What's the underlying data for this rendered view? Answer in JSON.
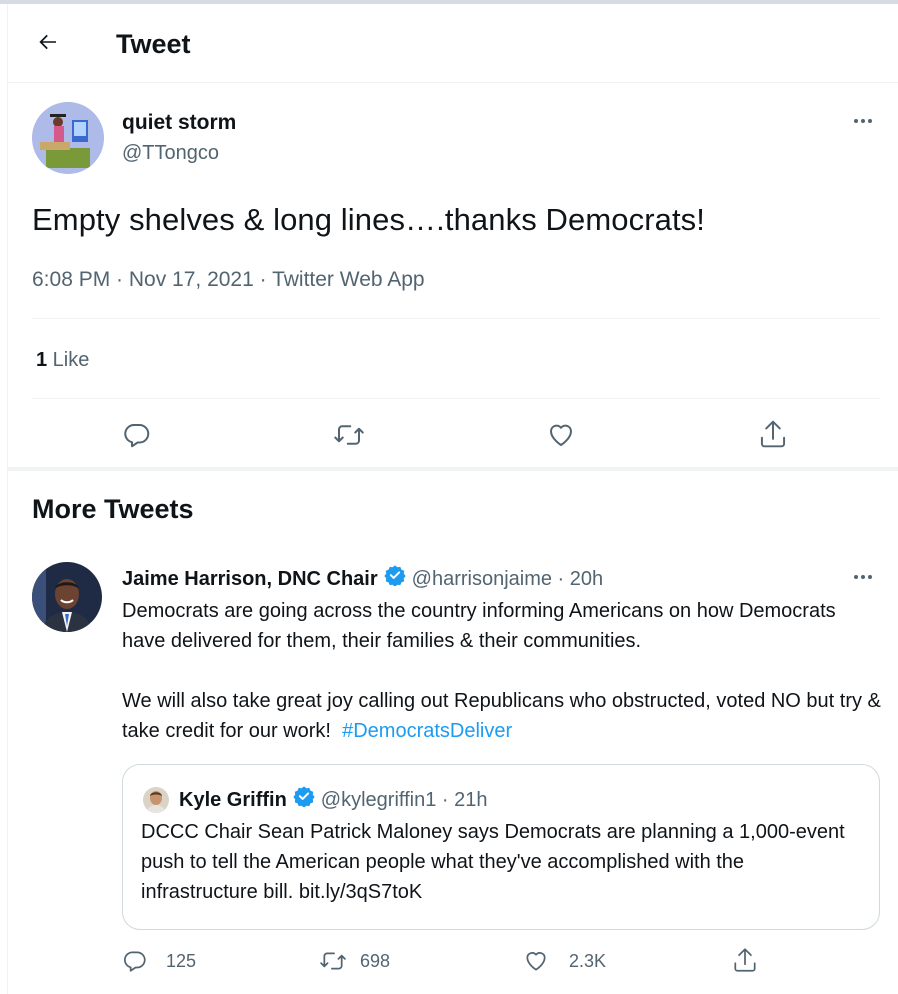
{
  "header": {
    "back_icon": "arrow-left-icon",
    "title": "Tweet"
  },
  "main_tweet": {
    "author_name": "quiet storm",
    "author_handle": "@TTongco",
    "text": "Empty shelves & long lines….thanks Democrats!",
    "meta": "6:08 PM · Nov 17, 2021 · Twitter Web App",
    "like_count": "1",
    "like_label": " Like",
    "actions": [
      "reply-icon",
      "retweet-icon",
      "like-icon",
      "share-icon"
    ]
  },
  "more_tweets": {
    "title": "More Tweets",
    "tweet": {
      "author_name": "Jaime Harrison, DNC Chair",
      "author_handle": "@harrisonjaime",
      "separator": " · ",
      "time": "20h",
      "paragraph1": "Democrats are going across the country informing Americans on how Democrats have delivered for them, their families & their communities.",
      "paragraph2": "We will also take great joy calling out Republicans who obstructed, voted NO but try & take credit for our work!",
      "hashtag": "#DemocratsDeliver",
      "quote": {
        "author_name": "Kyle Griffin",
        "author_handle": "@kylegriffin1",
        "separator": " · ",
        "time": "21h",
        "text": "DCCC Chair Sean Patrick Maloney says Democrats are planning a 1,000-event push to tell the American people what they've accomplished with the infrastructure bill. bit.ly/3qS7toK"
      },
      "stats": {
        "replies": "125",
        "retweets": "698",
        "likes": "2.3K"
      }
    }
  },
  "colors": {
    "text": "#0f1419",
    "secondary": "#536471",
    "accent": "#1d9bf0",
    "border": "#eff3f4"
  }
}
